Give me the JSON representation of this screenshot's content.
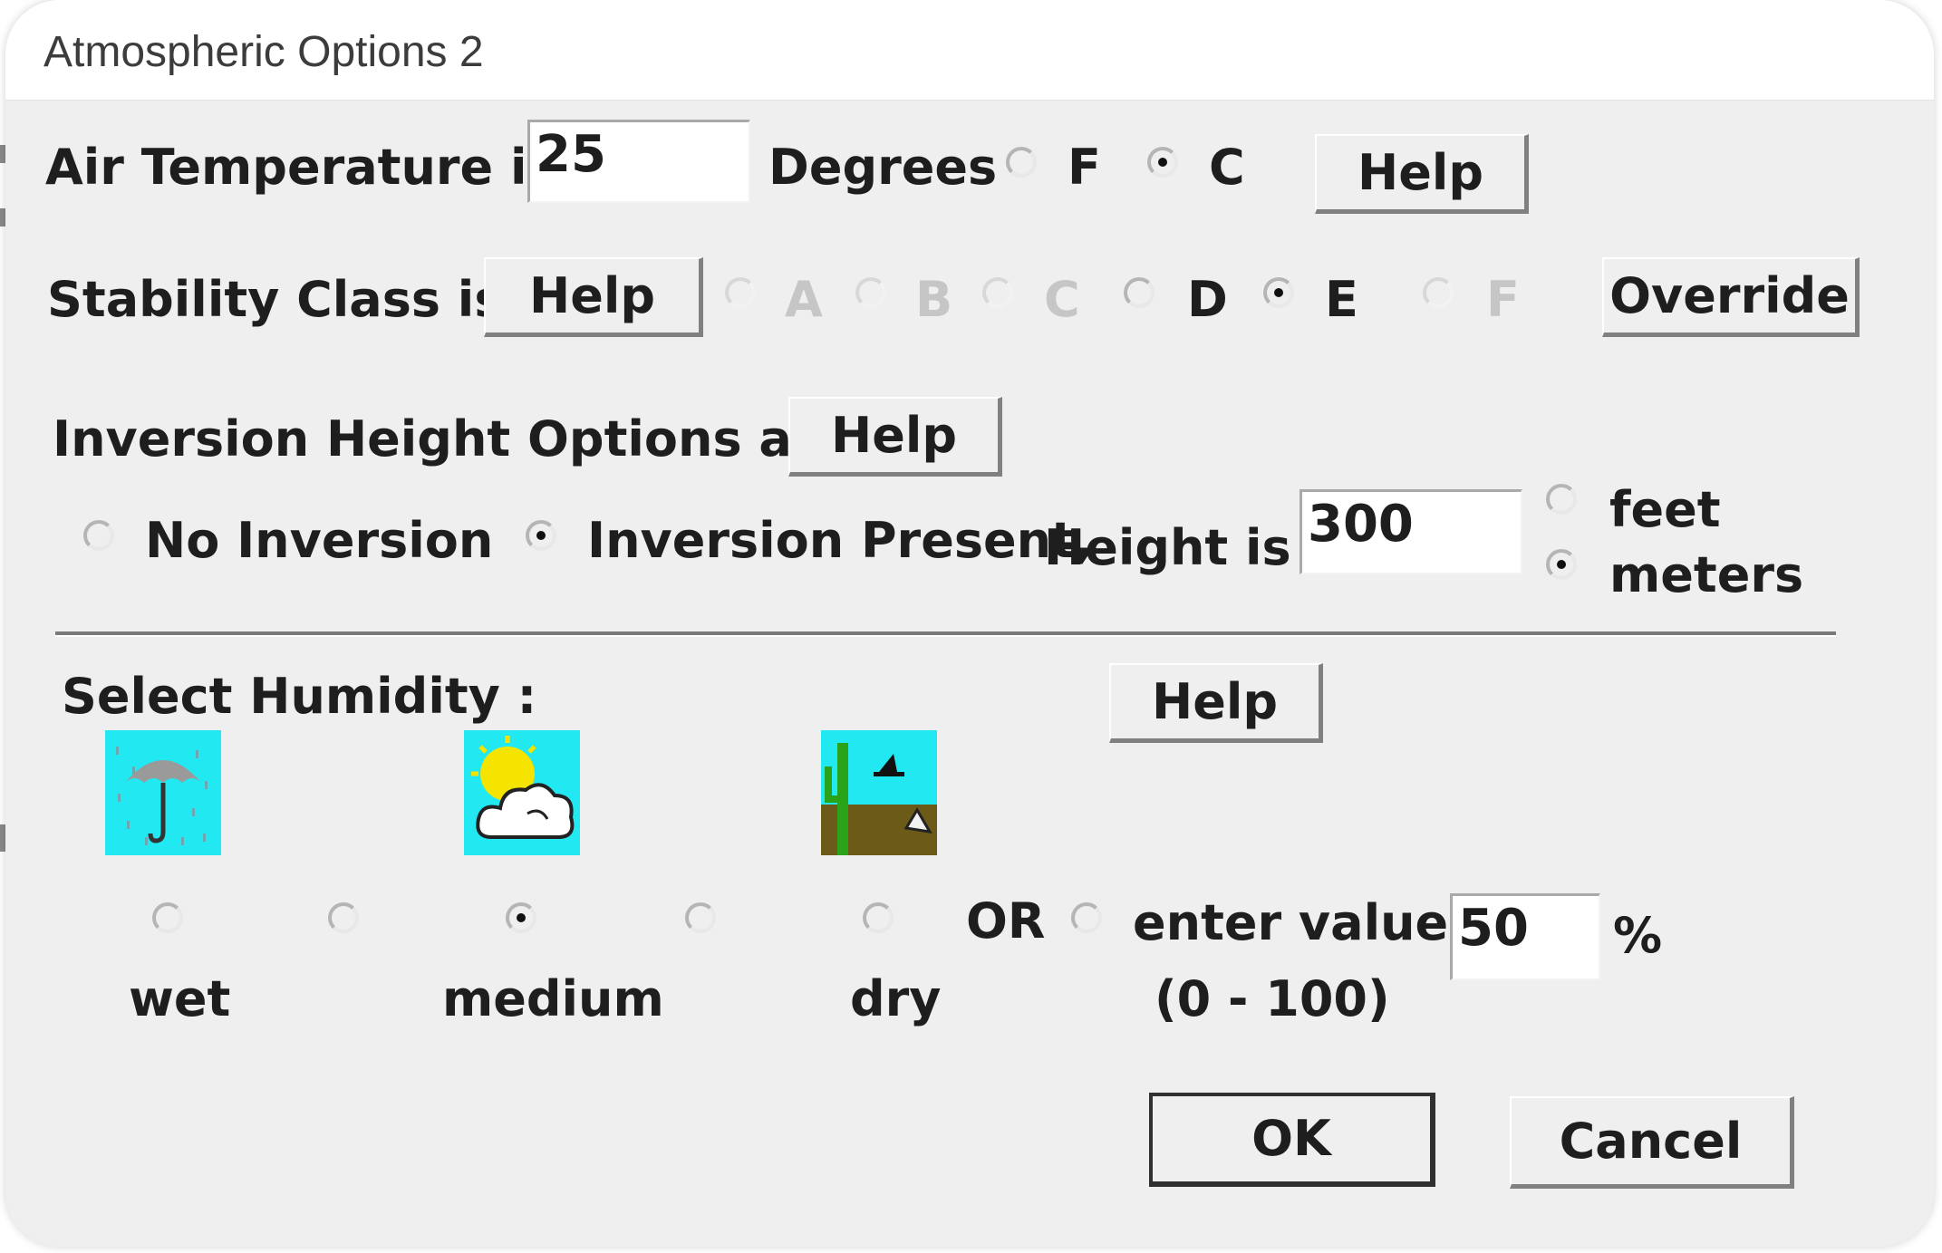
{
  "window": {
    "title": "Atmospheric Options 2"
  },
  "air_temperature": {
    "label": "Air Temperature is :",
    "value": "25",
    "units_label": "Degrees",
    "unit_options": [
      {
        "label": "F",
        "selected": false
      },
      {
        "label": "C",
        "selected": true
      }
    ],
    "help_label": "Help"
  },
  "stability": {
    "label": "Stability Class is :",
    "help_label": "Help",
    "classes": [
      {
        "label": "A",
        "selected": false,
        "enabled": false
      },
      {
        "label": "B",
        "selected": false,
        "enabled": false
      },
      {
        "label": "C",
        "selected": false,
        "enabled": false
      },
      {
        "label": "D",
        "selected": false,
        "enabled": true
      },
      {
        "label": "E",
        "selected": true,
        "enabled": true
      },
      {
        "label": "F",
        "selected": false,
        "enabled": false
      }
    ],
    "override_label": "Override"
  },
  "inversion": {
    "label": "Inversion Height Options are :",
    "help_label": "Help",
    "no_inversion_label": "No Inversion",
    "present_label": "Inversion Present,",
    "height_label": "Height is :",
    "height_value": "300",
    "units": [
      {
        "label": "feet",
        "selected": false
      },
      {
        "label": "meters",
        "selected": true
      }
    ]
  },
  "humidity": {
    "label": "Select Humidity :",
    "help_label": "Help",
    "icons": [
      "umbrella-rain-icon",
      "sun-cloud-icon",
      "cactus-desert-icon"
    ],
    "levels_selected": [
      false,
      false,
      true,
      false,
      false
    ],
    "wet_label": "wet",
    "medium_label": "medium",
    "dry_label": "dry",
    "or_label": "OR",
    "enter_value_label": "enter value :",
    "range_label": "(0 - 100)",
    "value": "50",
    "percent_label": "%"
  },
  "footer": {
    "ok_label": "OK",
    "cancel_label": "Cancel"
  },
  "colors": {
    "dialog_bg": "#efefef",
    "icon_sky": "#22e8f2",
    "sun": "#f5e400",
    "ground": "#6b5a18"
  }
}
